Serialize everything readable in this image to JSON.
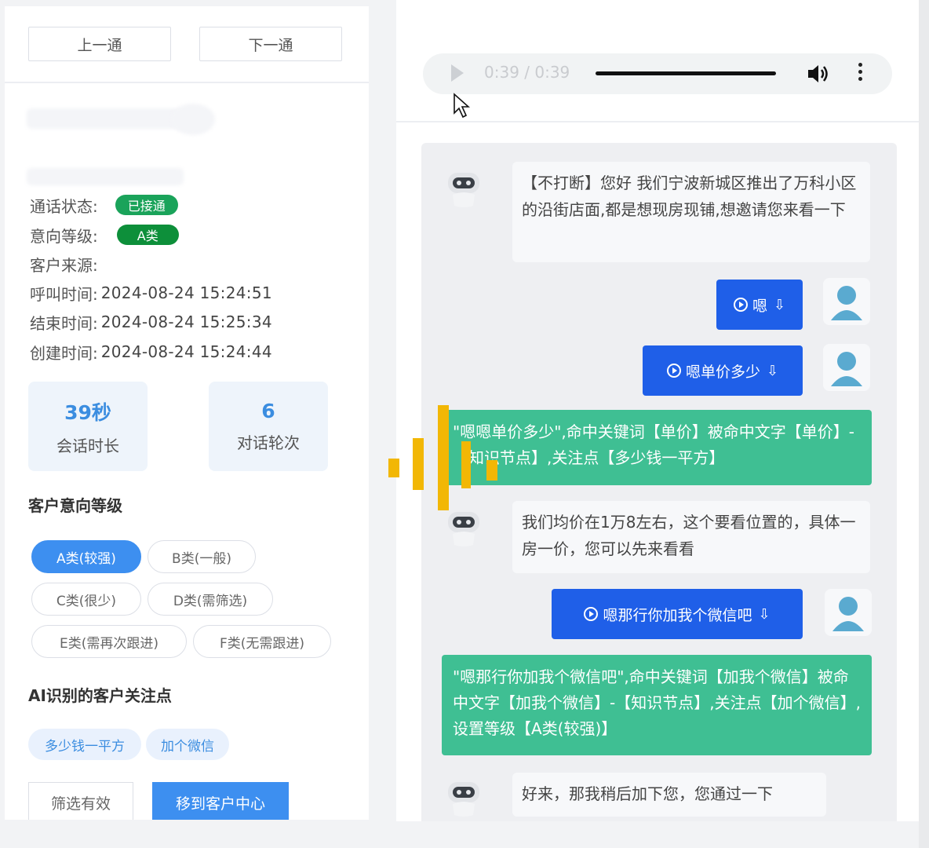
{
  "nav": {
    "prev": "上一通",
    "next": "下一通"
  },
  "call_info": {
    "status_key": "通话状态:",
    "status_value": "已接通",
    "grade_key": "意向等级:",
    "grade_value": "A类",
    "source_key": "客户来源:",
    "source_value": "",
    "call_time_key": "呼叫时间:",
    "call_time_value": "2024-08-24 15:24:51",
    "end_time_key": "结束时间:",
    "end_time_value": "2024-08-24 15:25:34",
    "create_time_key": "创建时间:",
    "create_time_value": "2024-08-24 15:24:44"
  },
  "stats": {
    "duration_value": "39秒",
    "duration_label": "会话时长",
    "rounds_value": "6",
    "rounds_label": "对话轮次"
  },
  "grade_section": {
    "title": "客户意向等级",
    "options": [
      "A类(较强)",
      "B类(一般)",
      "C类(很少)",
      "D类(需筛选)",
      "E类(需再次跟进)",
      "F类(无需跟进)"
    ],
    "selected": "A类(较强)"
  },
  "focus_section": {
    "title": "AI识别的客户关注点",
    "chips": [
      "多少钱一平方",
      "加个微信"
    ]
  },
  "actions": {
    "filter": "筛选有效",
    "move": "移到客户中心"
  },
  "audio": {
    "time": "0:39 / 0:39"
  },
  "chat": {
    "bot_1": "【不打断】您好 我们宁波新城区推出了万科小区的沿街店面,都是想现房现铺,想邀请您来看一下",
    "user_1": "嗯",
    "user_2": "嗯单价多少",
    "hit_1": "\"嗯嗯单价多少\",命中关键词【单价】被命中文字【单价】-【知识节点】,关注点【多少钱一平方】",
    "bot_2": "我们均价在1万8左右，这个要看位置的，具体一房一价，您可以先来看看",
    "user_3": "嗯那行你加我个微信吧",
    "hit_2": "\"嗯那行你加我个微信吧\",命中关键词【加我个微信】被命中文字【加我个微信】-【知识节点】,关注点【加个微信】,设置等级【A类(较强)】",
    "bot_3": "好来，那我稍后加下您，您通过一下"
  },
  "colors": {
    "user_bubble": "#1f5fe8",
    "hit_bubble": "#3fbf93",
    "selected_tag": "#3d8ff0",
    "status_green": "#1aa35a",
    "grade_green": "#0d8f3a"
  },
  "icons": [
    "play-icon",
    "volume-icon",
    "more-vert-icon",
    "robot-icon",
    "user-avatar-icon",
    "download-icon",
    "cursor-icon"
  ]
}
